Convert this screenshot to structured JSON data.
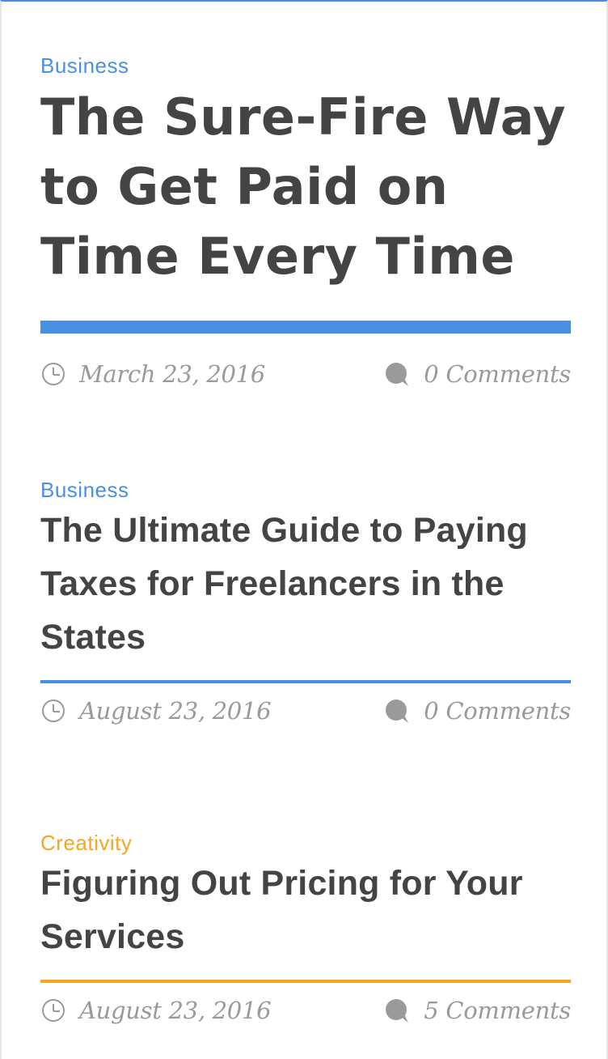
{
  "colors": {
    "business_accent": "#4a90e2",
    "creativity_accent": "#f5a623",
    "title_text": "#444444",
    "meta_text": "#9a9a9a"
  },
  "posts": [
    {
      "category": "Business",
      "category_color": "#4a90e2",
      "title": "The Sure-Fire Way to Get Paid on Time Every Time",
      "date": "March 23, 2016",
      "comments": "0 Comments",
      "date_icon": "clock-icon",
      "comments_icon": "comment-bubble-icon"
    },
    {
      "category": "Business",
      "category_color": "#4a90e2",
      "title": "The Ultimate Guide to Paying Taxes for Freelancers in the States",
      "date": "August 23, 2016",
      "comments": "0 Comments",
      "date_icon": "clock-icon",
      "comments_icon": "comment-bubble-icon"
    },
    {
      "category": "Creativity",
      "category_color": "#f5a623",
      "title": "Figuring Out Pricing for Your Services",
      "date": "August 23, 2016",
      "comments": "5 Comments",
      "date_icon": "clock-icon",
      "comments_icon": "comment-bubble-icon"
    }
  ]
}
